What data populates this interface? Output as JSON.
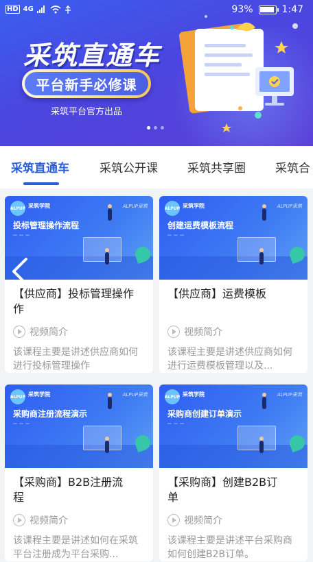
{
  "status_bar": {
    "carrier_badge": "HD",
    "network": "4G",
    "battery": "93%",
    "time": "1:47"
  },
  "banner": {
    "title": "采筑直通车",
    "pill_text": "平台新手必修课",
    "subtitle": "采筑平台官方出品",
    "active_dot": 1
  },
  "tabs": [
    {
      "label": "采筑直通车",
      "active": true
    },
    {
      "label": "采筑公开课",
      "active": false
    },
    {
      "label": "采筑共享圈",
      "active": false
    },
    {
      "label": "采筑合",
      "active": false
    }
  ],
  "thumb_common": {
    "logo": "ALPUP",
    "logo_name": "采筑学院",
    "brand": "ALPUP采筑"
  },
  "cards": [
    {
      "thumb_title": "投标管理操作流程",
      "title": "【供应商】投标管理操作",
      "title_wrap": "作",
      "video_label": "视频简介",
      "desc": "该课程主要是讲述供应商如何进行投标管理操作"
    },
    {
      "thumb_title": "创建运费模板流程",
      "title": "【供应商】运费模板",
      "title_wrap": "",
      "video_label": "视频简介",
      "desc": "该课程主要是讲述供应商如何进行运费模板管理以及..."
    },
    {
      "thumb_title": "采购商注册流程演示",
      "title": "【采购商】B2B注册流",
      "title_wrap": "程",
      "video_label": "视频简介",
      "desc": "该课程主要是讲述如何在采筑平台注册成为平台采购..."
    },
    {
      "thumb_title": "采购商创建订单演示",
      "title": "【采购商】创建B2B订",
      "title_wrap": "单",
      "video_label": "视频简介",
      "desc": "该课程主要是讲述平台采购商如何创建B2B订单。"
    }
  ],
  "colors": {
    "accent": "#2b5fd9",
    "banner_start": "#3a5ff0",
    "banner_end": "#5b3fd6"
  }
}
